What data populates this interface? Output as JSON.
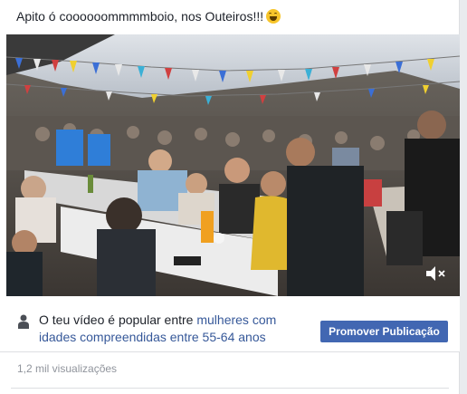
{
  "post": {
    "text": "Apito ó coooooommmmboio, nos Outeiros!!!",
    "emoji_icon": "smiling-squinting-face-emoji"
  },
  "video": {
    "description_icon": "video-player",
    "mute_icon": "speaker-muted-icon"
  },
  "insight": {
    "text_before": "O teu vídeo é popular entre ",
    "link_text": "mulheres com idades compreendidas entre 55-64 anos",
    "promote_label": "Promover Publicação"
  },
  "stats": {
    "views": "1,2 mil visualizações"
  },
  "colors": {
    "button": "#4267b2",
    "link": "#365899",
    "muted_text": "#90949c"
  }
}
